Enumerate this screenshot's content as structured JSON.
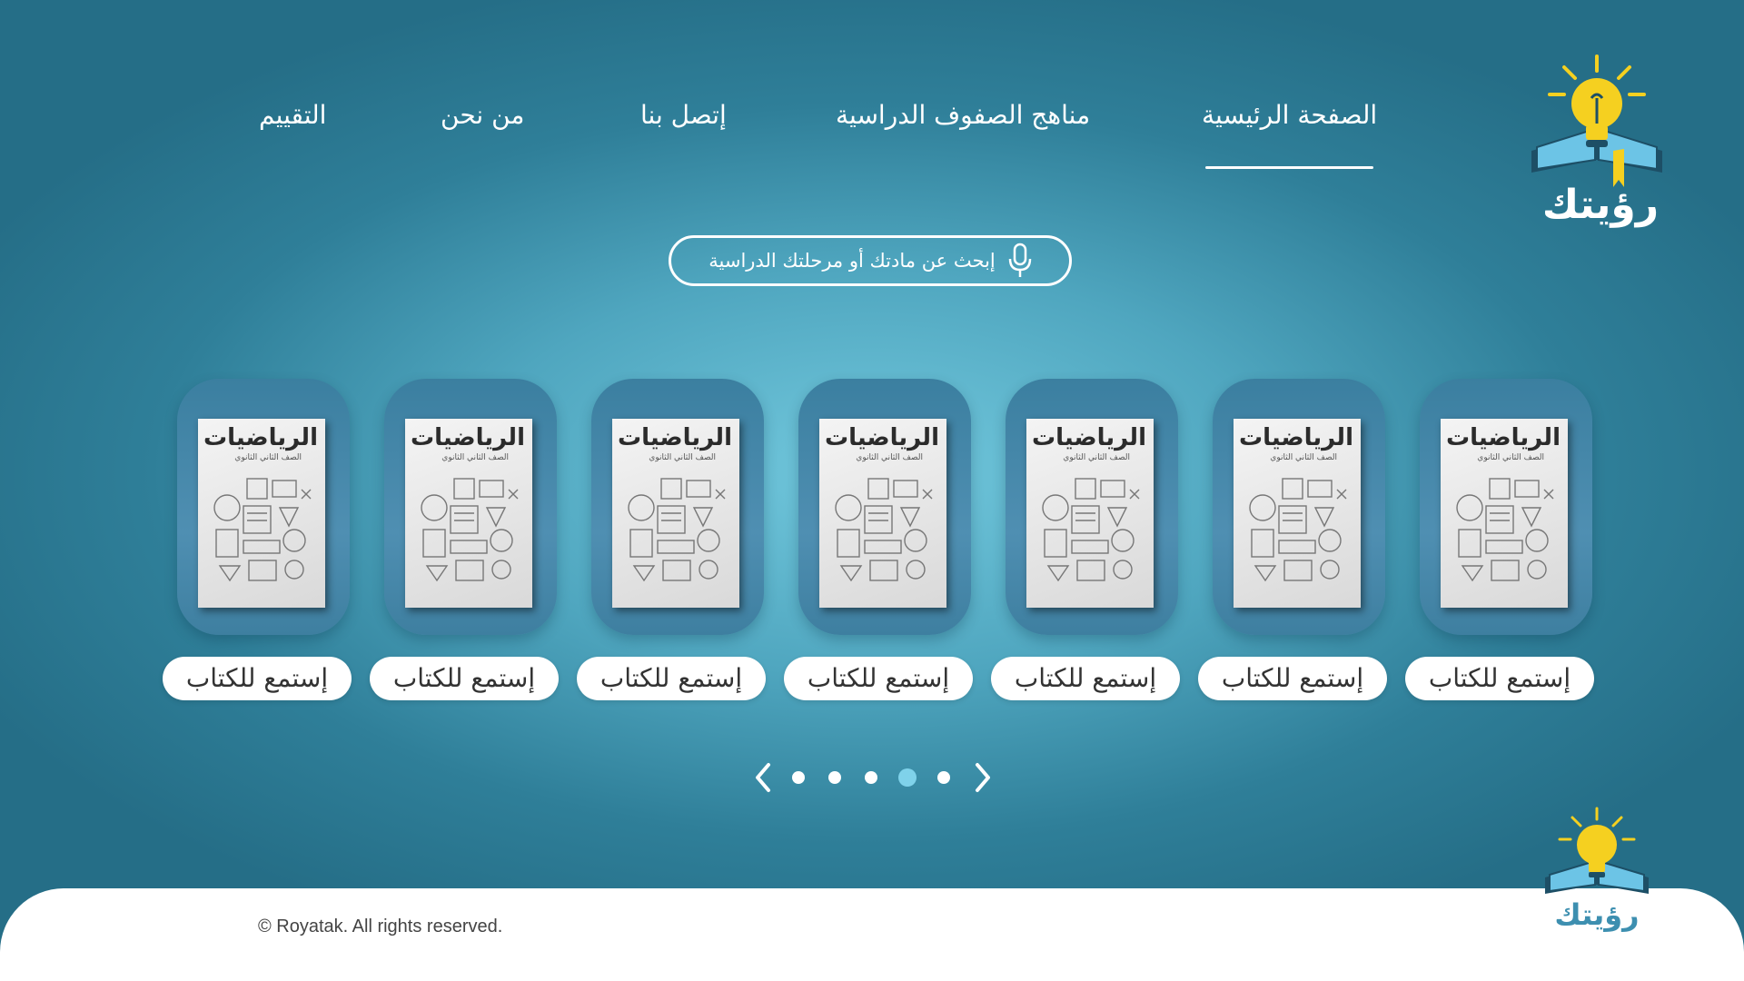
{
  "brand": {
    "name": "رؤيتك"
  },
  "nav": {
    "items": [
      {
        "label": "الصفحة الرئيسية",
        "active": true
      },
      {
        "label": "مناهج الصفوف الدراسية"
      },
      {
        "label": "إتصل بنا"
      },
      {
        "label": "من نحن"
      },
      {
        "label": "التقييم"
      }
    ]
  },
  "search": {
    "placeholder": "إبحث عن مادتك أو مرحلتك الدراسية",
    "icon": "microphone-icon"
  },
  "books": [
    {
      "title": "الرياضيات",
      "subtitle": "الصف الثاني الثانوي",
      "button": "إستمع للكتاب"
    },
    {
      "title": "الرياضيات",
      "subtitle": "الصف الثاني الثانوي",
      "button": "إستمع للكتاب"
    },
    {
      "title": "الرياضيات",
      "subtitle": "الصف الثاني الثانوي",
      "button": "إستمع للكتاب"
    },
    {
      "title": "الرياضيات",
      "subtitle": "الصف الثاني الثانوي",
      "button": "إستمع للكتاب"
    },
    {
      "title": "الرياضيات",
      "subtitle": "الصف الثاني الثانوي",
      "button": "إستمع للكتاب"
    },
    {
      "title": "الرياضيات",
      "subtitle": "الصف الثاني الثانوي",
      "button": "إستمع للكتاب"
    },
    {
      "title": "الرياضيات",
      "subtitle": "الصف الثاني الثانوي",
      "button": "إستمع للكتاب"
    }
  ],
  "pager": {
    "total": 5,
    "active": 4
  },
  "footer": {
    "copyright": "© Royatak. All rights reserved."
  },
  "colors": {
    "accent": "#7fd2ea",
    "bulb": "#f5d020",
    "book_blue": "#6cc4e6",
    "book_dark": "#1d4f66"
  }
}
